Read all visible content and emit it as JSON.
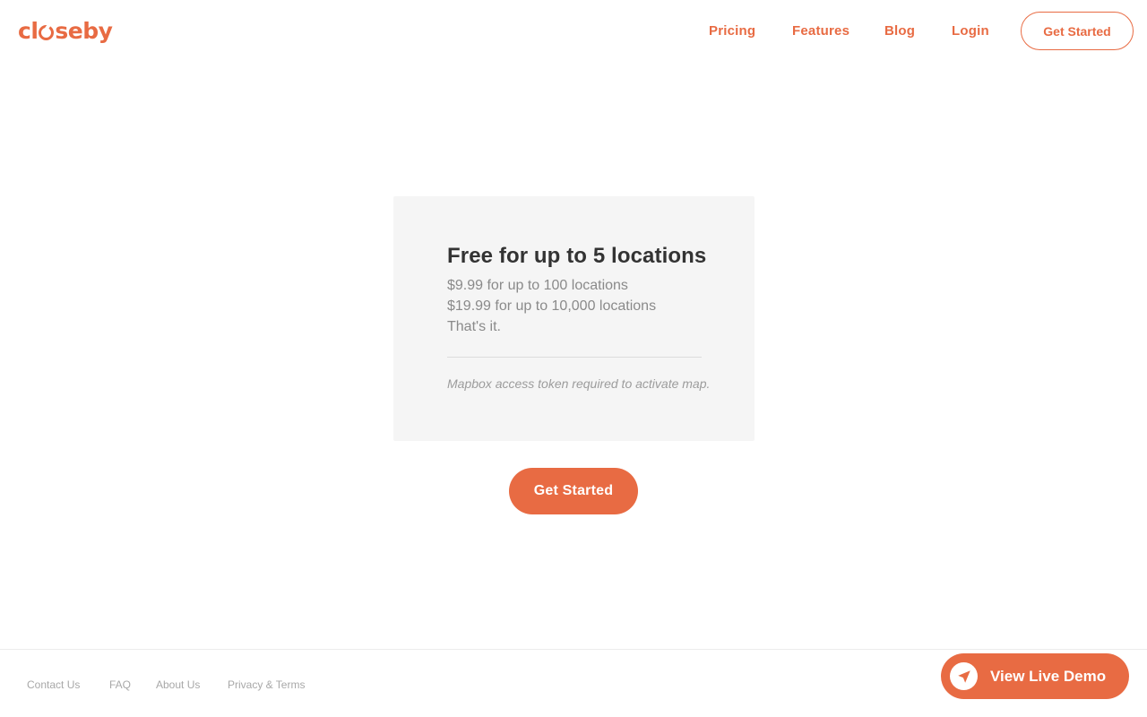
{
  "header": {
    "logo": {
      "prefix": "cl",
      "suffix": "seby"
    },
    "nav": {
      "pricing": "Pricing",
      "features": "Features",
      "blog": "Blog",
      "login": "Login",
      "cta": "Get Started"
    }
  },
  "pricing": {
    "headline": "Free for up to 5 locations",
    "tiers": [
      "$9.99 for up to 100 locations",
      "$19.99 for up to 10,000 locations",
      "That's it."
    ],
    "note": "Mapbox access token required to activate map."
  },
  "main_cta": "Get Started",
  "footer": {
    "links": [
      "Contact Us",
      "FAQ",
      "About Us",
      "Privacy & Terms"
    ]
  },
  "demo": {
    "label": "View Live Demo",
    "icon": "navigation-arrow-icon"
  },
  "colors": {
    "brand": "#e86b43",
    "card_bg": "#f5f5f5",
    "heading": "#333333",
    "muted": "#8a8a8a"
  }
}
